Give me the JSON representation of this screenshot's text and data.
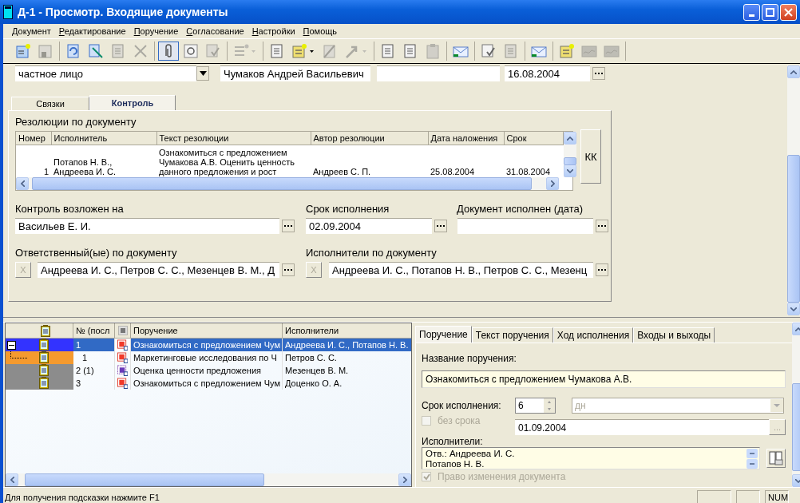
{
  "window": {
    "title": "Д-1 - Просмотр. Входящие документы"
  },
  "menu": [
    {
      "label": "Документ"
    },
    {
      "label": "Редактирование"
    },
    {
      "label": "Поручение"
    },
    {
      "label": "Согласование"
    },
    {
      "label": "Настройки"
    },
    {
      "label": "Помощь"
    }
  ],
  "toolbar": [
    [
      {
        "disabled": false,
        "pressed": false,
        "dropdown": false
      },
      {
        "disabled": true,
        "pressed": false,
        "dropdown": false
      }
    ],
    [
      {
        "disabled": false,
        "pressed": false,
        "dropdown": false
      },
      {
        "disabled": false,
        "pressed": false,
        "dropdown": false
      },
      {
        "disabled": true,
        "pressed": false,
        "dropdown": false
      },
      {
        "disabled": true,
        "pressed": false,
        "dropdown": false
      }
    ],
    [
      {
        "disabled": false,
        "pressed": true,
        "dropdown": false
      },
      {
        "disabled": false,
        "pressed": false,
        "dropdown": false
      },
      {
        "disabled": true,
        "pressed": false,
        "dropdown": false
      }
    ],
    [
      {
        "disabled": true,
        "pressed": false,
        "dropdown": true
      }
    ],
    [
      {
        "disabled": false,
        "pressed": false,
        "dropdown": false
      },
      {
        "disabled": false,
        "pressed": false,
        "dropdown": true
      },
      {
        "disabled": true,
        "pressed": false,
        "dropdown": false
      },
      {
        "disabled": true,
        "pressed": false,
        "dropdown": true
      }
    ],
    [
      {
        "disabled": false,
        "pressed": false,
        "dropdown": false
      },
      {
        "disabled": false,
        "pressed": false,
        "dropdown": false
      },
      {
        "disabled": true,
        "pressed": false,
        "dropdown": false
      }
    ],
    [
      {
        "disabled": false,
        "pressed": false,
        "dropdown": false
      }
    ],
    [
      {
        "disabled": false,
        "pressed": false,
        "dropdown": false
      },
      {
        "disabled": true,
        "pressed": false,
        "dropdown": false
      }
    ],
    [
      {
        "disabled": false,
        "pressed": false,
        "dropdown": false
      }
    ],
    [
      {
        "disabled": false,
        "pressed": false,
        "dropdown": false
      },
      {
        "disabled": true,
        "pressed": false,
        "dropdown": false
      },
      {
        "disabled": true,
        "pressed": false,
        "dropdown": false
      }
    ]
  ],
  "header_fields": {
    "sender_type": "частное лицо",
    "sender": "Чумаков Андрей Васильевич",
    "date": "16.08.2004"
  },
  "doc_tabs": [
    {
      "label": "Связки",
      "selected": false
    },
    {
      "label": "Контроль",
      "selected": true
    }
  ],
  "resolutions": {
    "title": "Резолюции по документу",
    "columns": [
      "Номер",
      "Исполнитель",
      "Текст резолюции",
      "Автор резолюции",
      "Дата наложения",
      "Срок"
    ],
    "rows": [
      [
        "1",
        "Потапов Н. В.,\nАндреева И. С.",
        "Ознакомиться с предложением\nЧумакова А.В. Оценить ценность\nданного предложения и рост",
        "Андреев С. П.",
        "25.08.2004",
        "31.08.2004"
      ]
    ],
    "button": "КК"
  },
  "control": {
    "controller_label": "Контроль возложен на",
    "controller": "Васильев Е. И.",
    "deadline_label": "Срок исполнения",
    "deadline": "02.09.2004",
    "done_label": "Документ исполнен (дата)",
    "responsible_label": "Ответственный(ые) по документу",
    "responsible": "Андреева И. С., Петров С. С., Мезенцев В. М., Д",
    "clear_button": "X",
    "executors_label": "Исполнители по документу",
    "executors": "Андреева И. С., Потапов Н. В., Петров С. С., Мезенц",
    "clear_button_2": "X"
  },
  "tasks": {
    "columns": [
      "№ (посл",
      "Поручение",
      "Исполнители"
    ],
    "rows": [
      {
        "number": "1",
        "task": "Ознакомиться с предложением Чум",
        "executors": "Андреева И. С., Потапов Н. В.",
        "color": "#3333ff",
        "kind": "solid",
        "selected": true,
        "expanded": true,
        "children": [
          {
            "number": "1",
            "task": "Маркетинговые исследования по Ч",
            "executors": "Петров С. С.",
            "color": "#f59a2e",
            "kind": "solid",
            "selected": false
          }
        ]
      },
      {
        "number": "2 (1)",
        "task": "Оценка ценности предложения",
        "executors": "Мезенцев В. М.",
        "color": "#8c8c8c",
        "kind": "dashed",
        "selected": false
      },
      {
        "number": "3",
        "task": "Ознакомиться с предложением Чум",
        "executors": "Доценко О. А.",
        "color": "#8c8c8c",
        "kind": "solid",
        "selected": false
      }
    ]
  },
  "task_tabs": [
    {
      "label": "Поручение",
      "selected": true
    },
    {
      "label": "Текст поручения",
      "selected": false
    },
    {
      "label": "Ход исполнения",
      "selected": false
    },
    {
      "label": "Входы и выходы",
      "selected": false
    }
  ],
  "task_form": {
    "name_label": "Название поручения:",
    "name": "Ознакомиться с предложением Чумакова А.В.",
    "term_label": "Срок исполнения:",
    "term": "6",
    "unit": "дн",
    "unit_disabled": true,
    "no_term": {
      "label": "без срока",
      "checked": false,
      "disabled": true
    },
    "due_date": "01.09.2004",
    "browse": "...",
    "executors_label": "Исполнители:",
    "executors": [
      "Отв.: Андреева И. С.",
      "Потапов Н. В."
    ],
    "edit_right": {
      "label": "Право изменения документа",
      "checked": true,
      "disabled": true
    }
  },
  "status_bar": {
    "hint": "Для получения подсказки нажмите F1",
    "panels": [
      "NUM"
    ]
  }
}
